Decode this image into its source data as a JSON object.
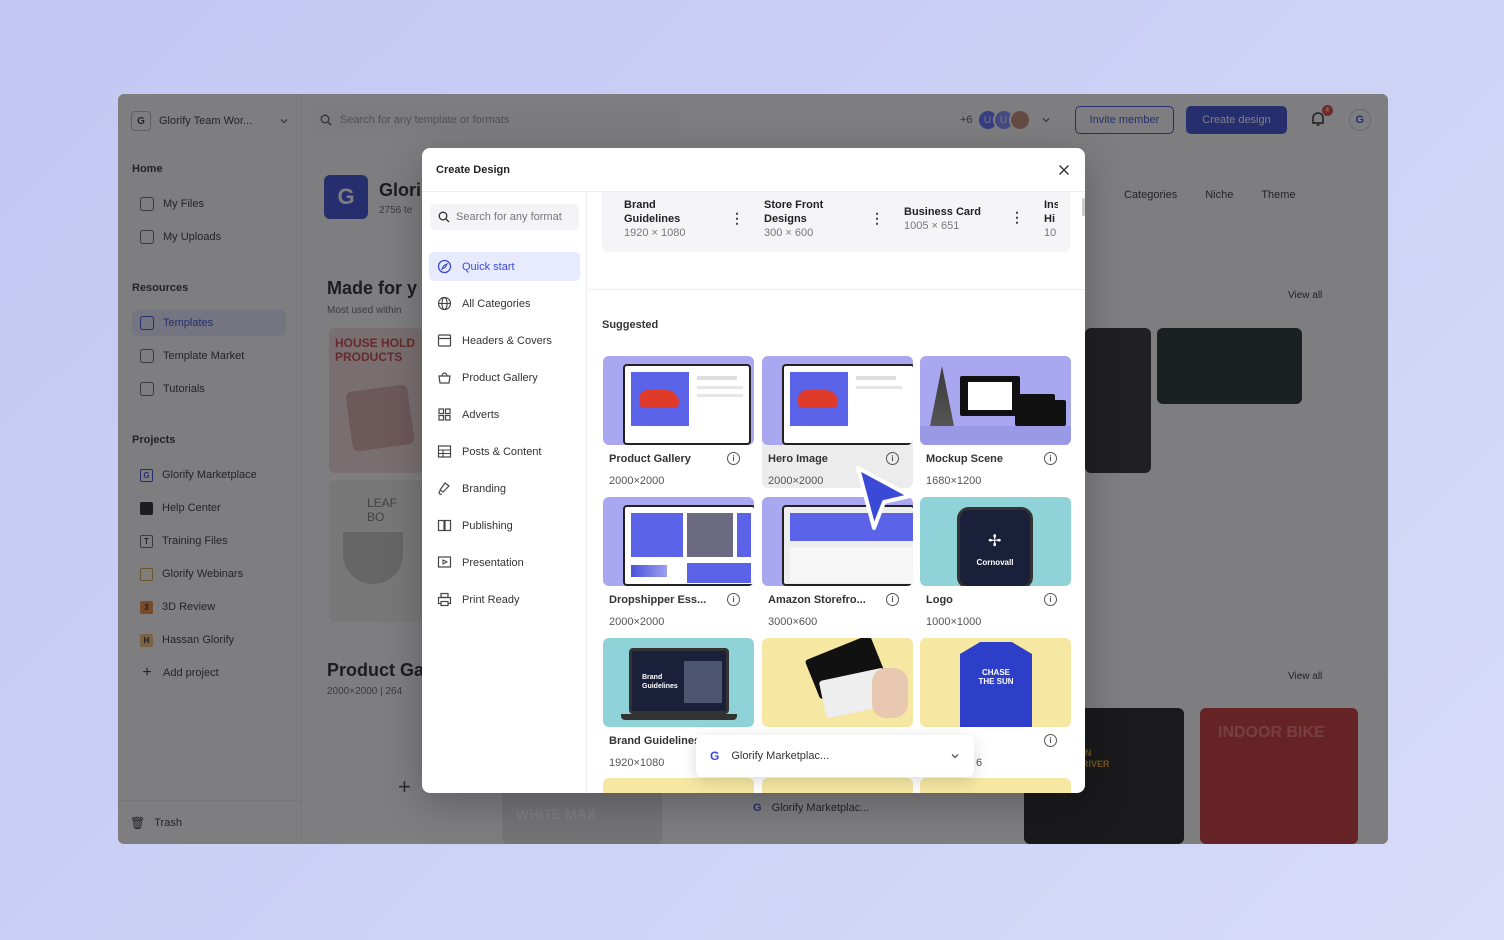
{
  "workspace": {
    "badge": "G",
    "name": "Glorify Team Wor..."
  },
  "topbar": {
    "search_placeholder": "Search for any template or formats",
    "avatars_more": "+6",
    "avatar_1": "U",
    "avatar_2": "U",
    "invite_label": "Invite member",
    "create_label": "Create design",
    "notification_count": "4",
    "profile_badge": "G"
  },
  "sidebar": {
    "home_label": "Home",
    "home_items": [
      {
        "label": "My Files"
      },
      {
        "label": "My Uploads"
      }
    ],
    "resources_label": "Resources",
    "resource_items": [
      {
        "label": "Templates"
      },
      {
        "label": "Template Market"
      },
      {
        "label": "Tutorials"
      }
    ],
    "projects_label": "Projects",
    "project_items": [
      {
        "label": "Glorify Marketplace",
        "badge": "G"
      },
      {
        "label": "Help Center",
        "badge": ""
      },
      {
        "label": "Training Files",
        "badge": "T"
      },
      {
        "label": "Glorify Webinars",
        "badge": ""
      },
      {
        "label": "3D Review",
        "badge": "3"
      },
      {
        "label": "Hassan Glorify",
        "badge": "H"
      }
    ],
    "add_project": "Add project",
    "trash": "Trash"
  },
  "main": {
    "team_badge": "G",
    "team_title": "Glori",
    "team_sub": "2756 te",
    "filters": [
      "Categories",
      "Niche",
      "Theme"
    ],
    "section1_title": "Made for y",
    "section1_sub": "Most used within",
    "section2_title": "Product Ga",
    "section2_sub": "2000×2000 | 264",
    "view_all": "View all",
    "card_text_1": "HOUSE HOLD PRODUCTS",
    "card_text_2": "LEAF BO",
    "card_text_3": "INDOOR BIKE",
    "card_text_4": "PRECISION SCREWDRIVER",
    "card_text_5": "WHITE MAX",
    "plus": "+",
    "bottom_popup": "Glorify Marketplac..."
  },
  "modal": {
    "title": "Create Design",
    "search_placeholder": "Search for any format",
    "categories": [
      {
        "label": "Quick start",
        "icon": "compass-icon"
      },
      {
        "label": "All Categories",
        "icon": "globe-icon"
      },
      {
        "label": "Headers & Covers",
        "icon": "header-icon"
      },
      {
        "label": "Product Gallery",
        "icon": "basket-icon"
      },
      {
        "label": "Adverts",
        "icon": "grid-icon"
      },
      {
        "label": "Posts & Content",
        "icon": "posts-icon"
      },
      {
        "label": "Branding",
        "icon": "brush-icon"
      },
      {
        "label": "Publishing",
        "icon": "book-icon"
      },
      {
        "label": "Presentation",
        "icon": "presentation-icon"
      },
      {
        "label": "Print Ready",
        "icon": "printer-icon"
      }
    ],
    "recent": [
      {
        "name": "Brand Guidelines",
        "size": "1920 × 1080"
      },
      {
        "name": "Store Front Designs",
        "size": "300 × 600"
      },
      {
        "name": "Business Card",
        "size": "1005 × 651"
      },
      {
        "name": "Ins Hi",
        "size": "10"
      }
    ],
    "suggested_label": "Suggested",
    "tiles": [
      {
        "label": "Product Gallery",
        "size": "2000×2000"
      },
      {
        "label": "Hero Image",
        "size": "2000×2000"
      },
      {
        "label": "Mockup Scene",
        "size": "1680×1200"
      },
      {
        "label": "Dropshipper Ess...",
        "size": "2000×2000"
      },
      {
        "label": "Amazon Storefro...",
        "size": "3000×600"
      },
      {
        "label": "Logo",
        "size": "1000×1000"
      },
      {
        "label": "Brand Guidelines",
        "size": "1920×1080"
      },
      {
        "label": "",
        "size": ""
      },
      {
        "label": "",
        "size": "6"
      }
    ],
    "thumb_texts": {
      "laptop_text": "Brand Guidelines",
      "phone_text": "Cornovall",
      "shirt_text": "CHASE THE SUN"
    },
    "popup_badge": "G",
    "popup_label": "Glorify Marketplac..."
  },
  "colors": {
    "accent": "#3a49d6",
    "thumb_purple": "#a8a7ef",
    "thumb_teal": "#8fd2d8",
    "thumb_yellow": "#f6e7a2"
  }
}
